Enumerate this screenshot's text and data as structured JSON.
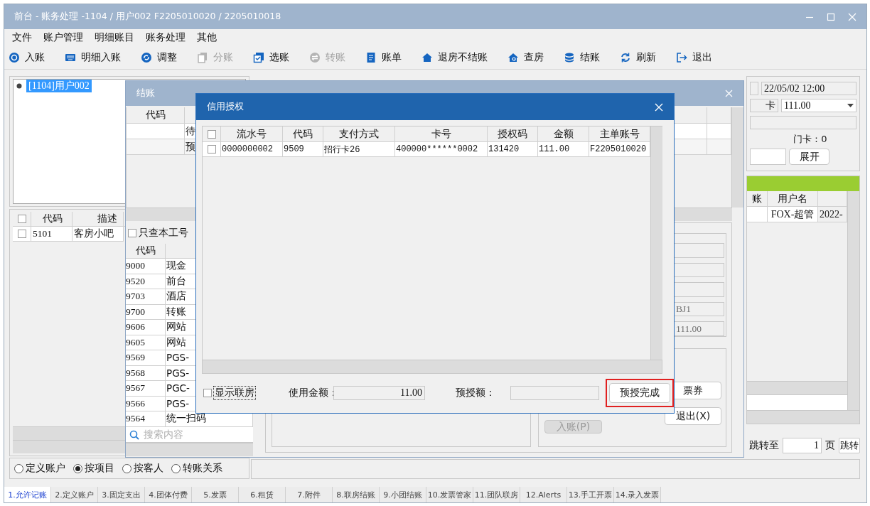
{
  "window": {
    "title": "前台 - 账务处理 -1104 / 用户002  F2205010020 / 2205010018"
  },
  "menu": [
    "文件",
    "账户管理",
    "明细账目",
    "账务处理",
    "其他"
  ],
  "toolbar": [
    {
      "label": "入账",
      "disabled": false
    },
    {
      "label": "明细入账",
      "disabled": false
    },
    {
      "label": "调整",
      "disabled": false
    },
    {
      "label": "分账",
      "disabled": true
    },
    {
      "label": "选账",
      "disabled": false
    },
    {
      "label": "转账",
      "disabled": true
    },
    {
      "label": "账单",
      "disabled": false
    },
    {
      "label": "退房不结账",
      "disabled": false
    },
    {
      "label": "查房",
      "disabled": false
    },
    {
      "label": "结账",
      "disabled": false
    },
    {
      "label": "刷新",
      "disabled": false
    },
    {
      "label": "退出",
      "disabled": false
    }
  ],
  "account_tree": [
    {
      "label": "[1104]用户002",
      "selected": true
    }
  ],
  "item_table": {
    "select_all": false,
    "columns": [
      "代码",
      "描述"
    ],
    "rows": [
      {
        "checked": false,
        "cells": [
          "5101",
          "客房小吧"
        ]
      }
    ]
  },
  "view_options": [
    {
      "label": "定义账户",
      "selected": false
    },
    {
      "label": "按项目",
      "selected": true
    },
    {
      "label": "按客人",
      "selected": false
    },
    {
      "label": "转账关系",
      "selected": false
    }
  ],
  "info_panel": {
    "date": "22/05/02 12:00",
    "card_label": "卡",
    "amount": "111.00",
    "door_card": "门卡：0",
    "expand_button": "展开"
  },
  "log_table": {
    "columns": [
      "账",
      "用户名"
    ],
    "rows": [
      {
        "user": "FOX-超管",
        "column_3": "2022-"
      }
    ]
  },
  "pager": {
    "label": "跳转至",
    "page": "1",
    "unit": "页",
    "button": "跳转"
  },
  "checkout_dialog": {
    "title": "结账",
    "table": {
      "columns": [
        "代码"
      ],
      "rows": [
        {
          "column_2": "待"
        },
        {
          "column_2": "预"
        }
      ]
    },
    "only_mine": {
      "label": "只查本工号",
      "checked": false
    },
    "payments": {
      "columns": [
        "代码"
      ],
      "rows": [
        {
          "code": "9000",
          "name": "现金"
        },
        {
          "code": "9520",
          "name": "前台"
        },
        {
          "code": "9703",
          "name": "酒店"
        },
        {
          "code": "9700",
          "name": "转账"
        },
        {
          "code": "9606",
          "name": "网站"
        },
        {
          "code": "9605",
          "name": "网站"
        },
        {
          "code": "9569",
          "name": "PGS-"
        },
        {
          "code": "9568",
          "name": "PGS-"
        },
        {
          "code": "9567",
          "name": "PGC-"
        },
        {
          "code": "9566",
          "name": "PGS-"
        },
        {
          "code": "9564",
          "name": "统一扫码"
        }
      ]
    },
    "search": {
      "placeholder": "搜索内容"
    },
    "fields": [
      "BJ1",
      "111.00"
    ],
    "buttons": [
      {
        "label": "票券",
        "disabled": false
      },
      {
        "label": "入账(P)",
        "disabled": true
      },
      {
        "label": "退出(X)",
        "disabled": false
      }
    ]
  },
  "auth_dialog": {
    "title": "信用授权",
    "select_all": false,
    "columns": [
      "流水号",
      "代码",
      "支付方式",
      "卡号",
      "授权码",
      "金额",
      "主单账号"
    ],
    "rows": [
      {
        "checked": false,
        "cells": [
          "0000000002",
          "9509",
          "招行卡26",
          "400000******0002",
          "131420",
          "111.00",
          "F2205010020"
        ]
      }
    ],
    "show_linked": {
      "label": "显示联房",
      "checked": false
    },
    "used_label": "使用金额：",
    "used_amount": "11.00",
    "preauth_label": "预授额：",
    "confirm_button": "预授完成"
  },
  "bottom_tabs": [
    {
      "label": "1.允许记账",
      "selected": true
    },
    {
      "label": "2.定义账户",
      "selected": false
    },
    {
      "label": "3.固定支出",
      "selected": false
    },
    {
      "label": "4.团体付费",
      "selected": false
    },
    {
      "label": "5.发票",
      "selected": false
    },
    {
      "label": "6.租赁",
      "selected": false
    },
    {
      "label": "7.附件",
      "selected": false
    },
    {
      "label": "8.联房结账",
      "selected": false
    },
    {
      "label": "9.小团结账",
      "selected": false
    },
    {
      "label": "10.发票管家",
      "selected": false
    },
    {
      "label": "11.团队联房",
      "selected": false
    },
    {
      "label": "12.Alerts",
      "selected": false
    },
    {
      "label": "13.手工开票",
      "selected": false
    },
    {
      "label": "14.录入发票",
      "selected": false
    }
  ]
}
